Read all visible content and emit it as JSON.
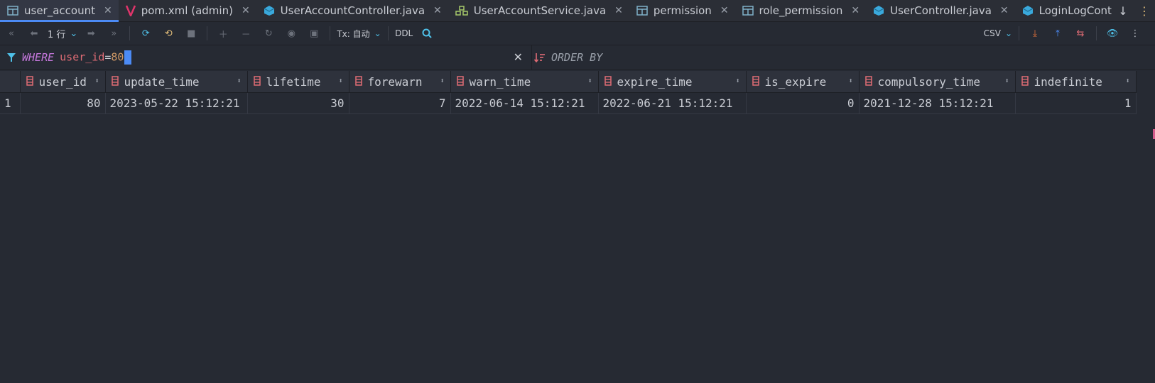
{
  "tabs": [
    {
      "label": "user_account",
      "icon": "table-icon",
      "active": true
    },
    {
      "label": "pom.xml (admin)",
      "icon": "maven-icon"
    },
    {
      "label": "UserAccountController.java",
      "icon": "java-class-icon"
    },
    {
      "label": "UserAccountService.java",
      "icon": "spring-service-icon"
    },
    {
      "label": "permission",
      "icon": "table-icon"
    },
    {
      "label": "role_permission",
      "icon": "table-icon"
    },
    {
      "label": "UserController.java",
      "icon": "java-class-icon"
    },
    {
      "label": "LoginLogController",
      "icon": "java-class-icon"
    }
  ],
  "toolbar": {
    "rows_label": "1 行",
    "tx_label": "Tx: 自动",
    "ddl_label": "DDL",
    "export_format": "CSV"
  },
  "filter": {
    "where_keyword": "WHERE",
    "where_field": "user_id",
    "where_op": "=",
    "where_value": "80",
    "order_keyword": "ORDER BY"
  },
  "grid": {
    "columns": [
      "user_id",
      "update_time",
      "lifetime",
      "forewarn",
      "warn_time",
      "expire_time",
      "is_expire",
      "compulsory_time",
      "indefinite"
    ],
    "rows": [
      {
        "row_number": "1",
        "cells": [
          "80",
          "2023-05-22 15:12:21",
          "30",
          "7",
          "2022-06-14 15:12:21",
          "2022-06-21 15:12:21",
          "0",
          "2021-12-28 15:12:21",
          "1"
        ]
      }
    ]
  },
  "colors": {
    "accent": "#4c8bf5",
    "keyword": "#c678dd",
    "column_icon": "#e06c75",
    "background": "#262a33"
  }
}
